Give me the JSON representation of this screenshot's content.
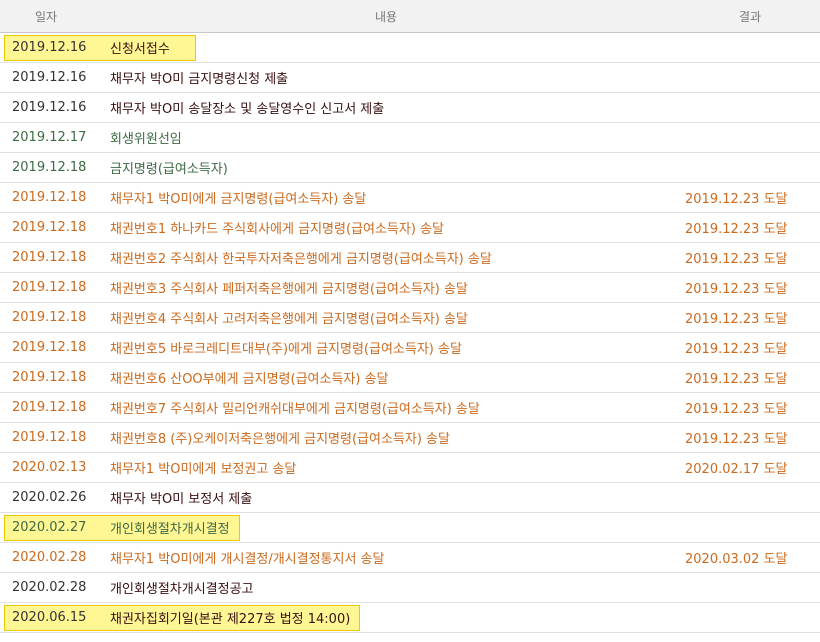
{
  "header": {
    "date": "일자",
    "content": "내용",
    "result": "결과"
  },
  "colors": {
    "dark": "#333333",
    "green": "#3d6a45",
    "orange": "#cc6a1e",
    "highlight": "#ffee3c"
  },
  "rows": [
    {
      "date": "2019.12.16",
      "content": "신청서접수",
      "result": "",
      "style": "dark",
      "highlighted": true
    },
    {
      "date": "2019.12.16",
      "content": "채무자 박O미 금지명령신청 제출",
      "result": "",
      "style": "dark",
      "highlighted": false
    },
    {
      "date": "2019.12.16",
      "content": "채무자 박O미 송달장소 및 송달영수인 신고서 제출",
      "result": "",
      "style": "dark",
      "highlighted": false
    },
    {
      "date": "2019.12.17",
      "content": "회생위원선임",
      "result": "",
      "style": "green",
      "highlighted": false
    },
    {
      "date": "2019.12.18",
      "content": "금지명령(급여소득자)",
      "result": "",
      "style": "green",
      "highlighted": false
    },
    {
      "date": "2019.12.18",
      "content": "채무자1 박O미에게 금지명령(급여소득자) 송달",
      "result": "2019.12.23 도달",
      "style": "orange",
      "highlighted": false
    },
    {
      "date": "2019.12.18",
      "content": "채권번호1 하나카드 주식회사에게 금지명령(급여소득자) 송달",
      "result": "2019.12.23 도달",
      "style": "orange",
      "highlighted": false
    },
    {
      "date": "2019.12.18",
      "content": "채권번호2 주식회사 한국투자저축은행에게 금지명령(급여소득자) 송달",
      "result": "2019.12.23 도달",
      "style": "orange",
      "highlighted": false
    },
    {
      "date": "2019.12.18",
      "content": "채권번호3 주식회사 페퍼저축은행에게 금지명령(급여소득자) 송달",
      "result": "2019.12.23 도달",
      "style": "orange",
      "highlighted": false
    },
    {
      "date": "2019.12.18",
      "content": "채권번호4 주식회사 고려저축은행에게 금지명령(급여소득자) 송달",
      "result": "2019.12.23 도달",
      "style": "orange",
      "highlighted": false
    },
    {
      "date": "2019.12.18",
      "content": "채권번호5 바로크레디트대부(주)에게 금지명령(급여소득자) 송달",
      "result": "2019.12.23 도달",
      "style": "orange",
      "highlighted": false
    },
    {
      "date": "2019.12.18",
      "content": "채권번호6 산OO부에게 금지명령(급여소득자) 송달",
      "result": "2019.12.23 도달",
      "style": "orange",
      "highlighted": false
    },
    {
      "date": "2019.12.18",
      "content": "채권번호7 주식회사 밀리언캐쉬대부에게 금지명령(급여소득자) 송달",
      "result": "2019.12.23 도달",
      "style": "orange",
      "highlighted": false
    },
    {
      "date": "2019.12.18",
      "content": "채권번호8 (주)오케이저축은행에게 금지명령(급여소득자) 송달",
      "result": "2019.12.23 도달",
      "style": "orange",
      "highlighted": false
    },
    {
      "date": "2020.02.13",
      "content": "채무자1 박O미에게 보정권고 송달",
      "result": "2020.02.17 도달",
      "style": "orange",
      "highlighted": false
    },
    {
      "date": "2020.02.26",
      "content": "채무자 박O미 보정서 제출",
      "result": "",
      "style": "dark",
      "highlighted": false
    },
    {
      "date": "2020.02.27",
      "content": "개인회생절차개시결정",
      "result": "",
      "style": "green",
      "highlighted": true
    },
    {
      "date": "2020.02.28",
      "content": "채무자1 박O미에게 개시결정/개시결정통지서 송달",
      "result": "2020.03.02 도달",
      "style": "orange",
      "highlighted": false
    },
    {
      "date": "2020.02.28",
      "content": "개인회생절차개시결정공고",
      "result": "",
      "style": "dark",
      "highlighted": false
    },
    {
      "date": "2020.06.15",
      "content": "채권자집회기일(본관 제227호 법정 14:00)",
      "result": "",
      "style": "dark",
      "highlighted": true
    }
  ]
}
